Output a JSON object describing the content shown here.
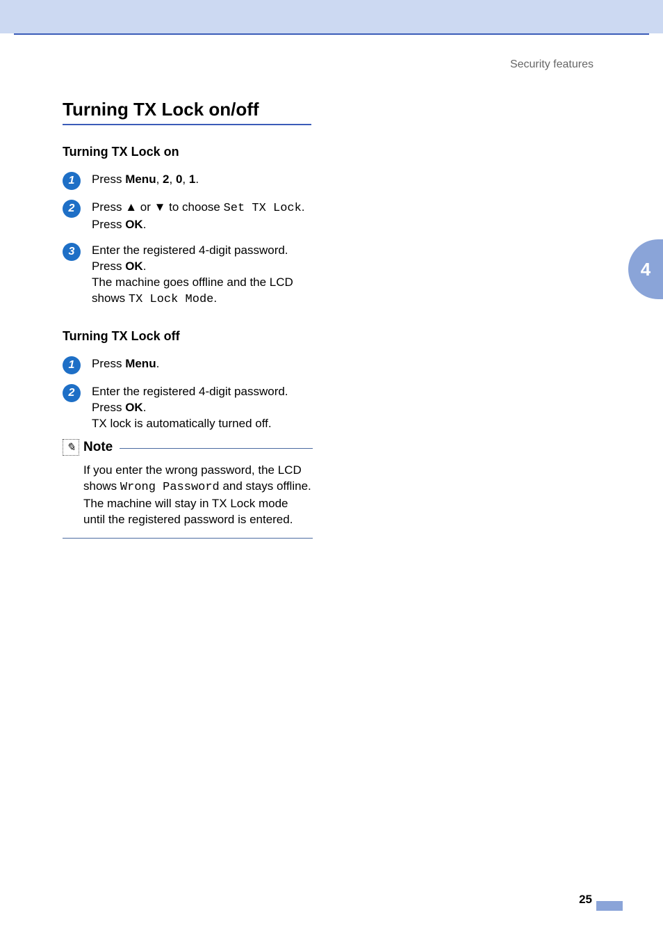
{
  "header": {
    "label": "Security features"
  },
  "heading": "Turning TX Lock on/off",
  "on": {
    "title": "Turning TX Lock on",
    "steps": [
      {
        "num": "1",
        "press": "Press ",
        "menu": "Menu",
        "sep": ", ",
        "k2": "2",
        "k0": "0",
        "k1": "1",
        "dot": "."
      },
      {
        "num": "2",
        "press": "Press ",
        "up": "▲",
        "or": " or ",
        "down": "▼",
        "tochoose": " to choose ",
        "settx": "Set TX Lock",
        "dot": ".",
        "press2": "Press ",
        "ok": "OK",
        "dot2": "."
      },
      {
        "num": "3",
        "l1": "Enter the registered 4-digit password.",
        "press2": "Press ",
        "ok": "OK",
        "dot2": ".",
        "l3a": "The machine goes offline and the LCD shows ",
        "mode": "TX Lock Mode",
        "l3dot": "."
      }
    ]
  },
  "off": {
    "title": "Turning TX Lock off",
    "steps": [
      {
        "num": "1",
        "press": "Press ",
        "menu": "Menu",
        "dot": "."
      },
      {
        "num": "2",
        "l1": "Enter the registered 4-digit password.",
        "press2": "Press ",
        "ok": "OK",
        "dot2": ".",
        "l3": "TX lock is automatically turned off."
      }
    ]
  },
  "note": {
    "title": "Note",
    "t1": "If you enter the wrong password, the LCD shows ",
    "wrong": "Wrong Password",
    "t2": " and stays offline. The machine will stay in TX Lock mode until the registered password is entered."
  },
  "sidetab": "4",
  "pagenum": "25"
}
